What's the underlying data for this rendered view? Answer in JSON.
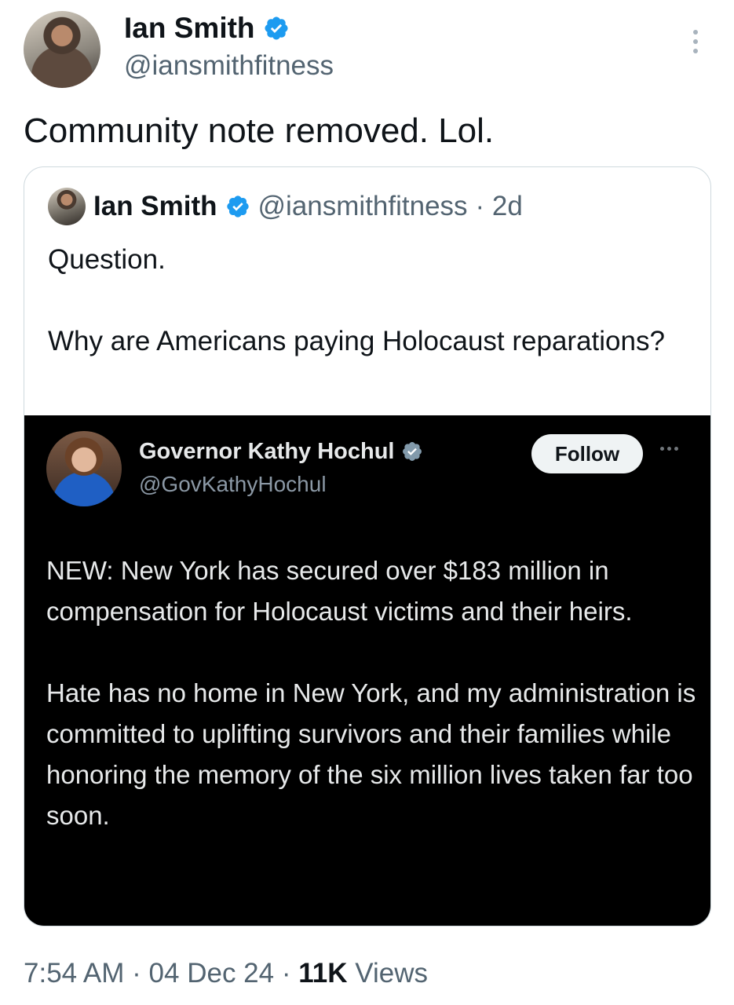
{
  "tweet": {
    "author_name": "Ian Smith",
    "author_handle": "@iansmithfitness",
    "text": "Community note removed. Lol.",
    "time": "7:54 AM",
    "date": "04 Dec 24",
    "views_count": "11K",
    "views_label": "Views",
    "separator": "·"
  },
  "quoted": {
    "author_name": "Ian Smith",
    "author_handle": "@iansmithfitness",
    "age": "· 2d",
    "paragraphs": [
      "Question.",
      "Why are Americans paying Holocaust reparations?"
    ]
  },
  "embedded": {
    "author_name": "Governor Kathy Hochul",
    "author_handle": "@GovKathyHochul",
    "follow_label": "Follow",
    "paragraphs": [
      "NEW: New York has secured over $183 million in compensation for Holocaust victims and their heirs.",
      "Hate has no home in New York, and my administration is committed to uplifting survivors and their families while honoring the memory of the six million lives taken far too soon."
    ]
  },
  "colors": {
    "verified_blue": "#1d9bf0",
    "verified_gray": "#829aab",
    "muted_text": "#536471"
  },
  "icons": {
    "verified": "verified-badge-icon",
    "gov_verified": "government-badge-icon",
    "more": "more-options-icon"
  }
}
